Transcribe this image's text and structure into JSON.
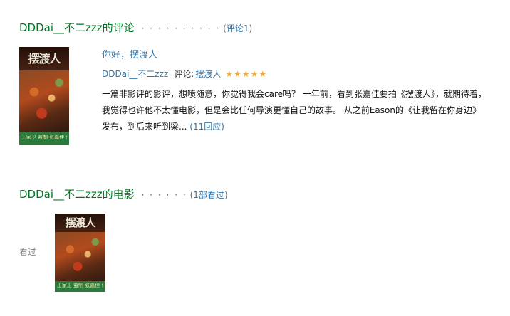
{
  "reviews": {
    "section_title": "DDDai__不二zzz的评论",
    "dots": "· · · · · · · · · ·",
    "count_open": "(",
    "count_text": "评论1",
    "count_close": ")",
    "item": {
      "title": "你好，摆渡人",
      "author": "DDDai__不二zzz",
      "label": "评论:",
      "movie": "摆渡人",
      "rating_stars": 5,
      "excerpt": "一篇非影评的影评，想喷随意，你觉得我会care吗？ 一年前，看到张嘉佳要拍《摆渡人》，就期待着，我觉得也许他不太懂电影，但是会比任何导演更懂自己的故事。 从之前Eason的《让我留在你身边》发布，到后来听到梁...",
      "more_link": "(11回应)",
      "poster": {
        "title_art": "摆渡人",
        "credit": "王家卫 监制  张嘉佳 作品",
        "icon": "movie-poster"
      }
    }
  },
  "movies": {
    "section_title": "DDDai__不二zzz的电影",
    "dots": "· · · · · ·",
    "count_open": "(",
    "count_text": "1部看过",
    "count_close": ")",
    "seen_label": "看过",
    "poster": {
      "title_art": "摆渡人",
      "credit": "王家卫 监制  张嘉佳 作品",
      "icon": "movie-poster"
    }
  },
  "colors": {
    "section_green": "#007722",
    "link_blue": "#3377aa",
    "star_orange": "#f3a82b"
  }
}
